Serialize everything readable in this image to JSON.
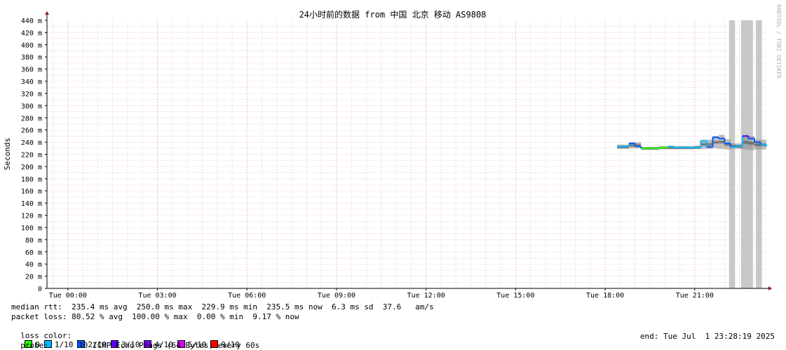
{
  "chart_data": {
    "type": "line",
    "title": "24小时前的数据 from 中国 北京 移动 AS9808",
    "watermark": "RRDTOOL / TOBI OETIKER",
    "ylabel": "Seconds",
    "ylim": [
      0,
      440
    ],
    "y_ticks": [
      "0",
      "20 m",
      "40 m",
      "60 m",
      "80 m",
      "100 m",
      "120 m",
      "140 m",
      "160 m",
      "180 m",
      "200 m",
      "220 m",
      "240 m",
      "260 m",
      "280 m",
      "300 m",
      "320 m",
      "340 m",
      "360 m",
      "380 m",
      "400 m",
      "420 m",
      "440 m"
    ],
    "xlim_hours": [
      23.3,
      47.4
    ],
    "x_ticks": [
      {
        "h": 24,
        "label": "Tue 00:00"
      },
      {
        "h": 27,
        "label": "Tue 03:00"
      },
      {
        "h": 30,
        "label": "Tue 06:00"
      },
      {
        "h": 33,
        "label": "Tue 09:00"
      },
      {
        "h": 36,
        "label": "Tue 12:00"
      },
      {
        "h": 39,
        "label": "Tue 15:00"
      },
      {
        "h": 42,
        "label": "Tue 18:00"
      },
      {
        "h": 45,
        "label": "Tue 21:00"
      }
    ],
    "grid": true,
    "loss_colors": {
      "0": "#26ff00",
      "1/10": "#00b8ff",
      "2/10": "#0059ff",
      "3/10": "#5e00ff",
      "4/10": "#7e00ff",
      "5/10": "#dd00ff",
      "9/10": "#ff0000"
    },
    "loss_bars": [
      [
        46.15,
        46.35
      ],
      [
        46.55,
        46.95
      ],
      [
        47.05,
        47.25
      ]
    ],
    "median_rtt_ms": [
      [
        42.4,
        233,
        "1/10"
      ],
      [
        42.6,
        233,
        "1/10"
      ],
      [
        42.8,
        238,
        "2/10"
      ],
      [
        43.0,
        233,
        "2/10"
      ],
      [
        43.2,
        230,
        "0"
      ],
      [
        43.6,
        230,
        "0"
      ],
      [
        43.8,
        231,
        "0"
      ],
      [
        44.1,
        233,
        "1/10"
      ],
      [
        44.3,
        231,
        "1/10"
      ],
      [
        45.0,
        231,
        "1/10"
      ],
      [
        45.2,
        242,
        "1/10"
      ],
      [
        45.4,
        232,
        "2/10"
      ],
      [
        45.6,
        248,
        "2/10"
      ],
      [
        45.8,
        246,
        "2/10"
      ],
      [
        46.0,
        238,
        "2/10"
      ],
      [
        46.2,
        232,
        "1/10"
      ],
      [
        46.4,
        234,
        "1/10"
      ],
      [
        46.6,
        250,
        "3/10"
      ],
      [
        46.8,
        246,
        "2/10"
      ],
      [
        47.0,
        240,
        "2/10"
      ],
      [
        47.2,
        236,
        "1/10"
      ],
      [
        47.4,
        233,
        "1/10"
      ]
    ],
    "smoke": [
      [
        42.4,
        229,
        236
      ],
      [
        42.8,
        230,
        240
      ],
      [
        43.2,
        228,
        232
      ],
      [
        43.8,
        229,
        233
      ],
      [
        44.3,
        229,
        233
      ],
      [
        45.0,
        229,
        234
      ],
      [
        45.2,
        229,
        244
      ],
      [
        45.6,
        230,
        250
      ],
      [
        45.8,
        229,
        252
      ],
      [
        46.0,
        228,
        245
      ],
      [
        46.2,
        229,
        238
      ],
      [
        46.6,
        228,
        252
      ],
      [
        46.8,
        227,
        250
      ],
      [
        47.0,
        228,
        244
      ],
      [
        47.4,
        228,
        236
      ]
    ]
  },
  "stats": {
    "median_rtt": "median rtt:  235.4 ms avg  250.0 ms max  229.9 ms min  235.5 ms now  6.3 ms sd  37.6   am/s",
    "packet_loss": "packet loss: 80.52 % avg  100.00 % max  0.00 % min  9.17 % now",
    "loss_color_label": "loss color:",
    "loss_legend": [
      {
        "label": "0",
        "color": "#26ff00"
      },
      {
        "label": "1/10",
        "color": "#00b8ff"
      },
      {
        "label": "2/10",
        "color": "#0059ff"
      },
      {
        "label": "3/10",
        "color": "#5e00ff"
      },
      {
        "label": "4/10",
        "color": "#7e00ff"
      },
      {
        "label": "5/10",
        "color": "#dd00ff"
      },
      {
        "label": "9/10",
        "color": "#ff0000"
      }
    ],
    "probe_label": "probe:",
    "probe": "10 ICMP Echo Pings (64 Bytes) every 60s",
    "end": "end: Tue Jul  1 23:28:19 2025"
  }
}
